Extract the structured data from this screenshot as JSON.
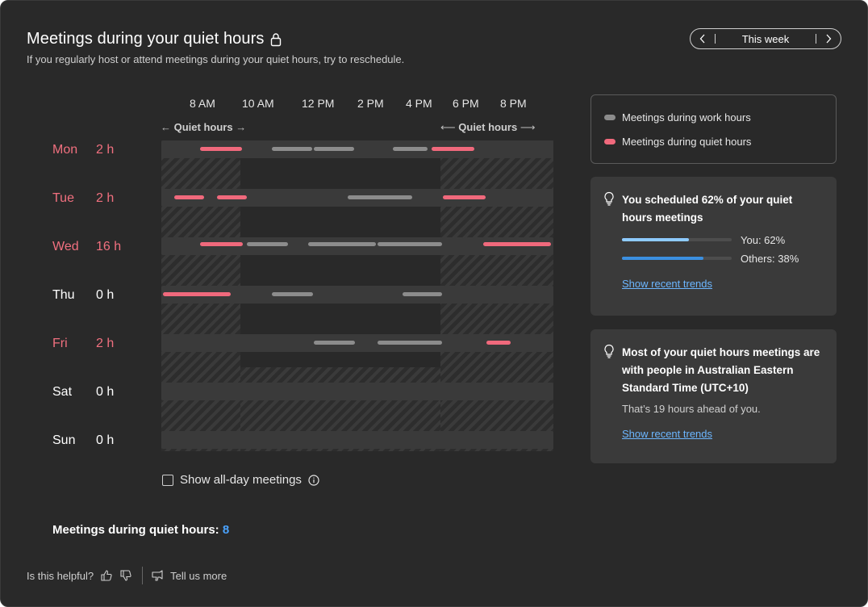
{
  "header": {
    "title": "Meetings during your quiet hours",
    "subtitle": "If you regularly host or attend meetings during your quiet hours, try to reschedule.",
    "week_label": "This week"
  },
  "timeline": {
    "hours": [
      "8 AM",
      "10 AM",
      "12 PM",
      "2 PM",
      "4 PM",
      "6 PM",
      "8 PM"
    ],
    "quiet_hours_label": "Quiet hours",
    "work_hours": {
      "start": "10 AM",
      "end": "6 PM"
    }
  },
  "days": [
    {
      "name": "Mon",
      "hours": "2 h",
      "has_quiet": true
    },
    {
      "name": "Tue",
      "hours": "2 h",
      "has_quiet": true
    },
    {
      "name": "Wed",
      "hours": "16 h",
      "has_quiet": true
    },
    {
      "name": "Thu",
      "hours": "0 h",
      "has_quiet": false
    },
    {
      "name": "Fri",
      "hours": "2 h",
      "has_quiet": true
    },
    {
      "name": "Sat",
      "hours": "0 h",
      "has_quiet": false
    },
    {
      "name": "Sun",
      "hours": "0 h",
      "has_quiet": false
    }
  ],
  "options": {
    "all_day_label": "Show all-day meetings"
  },
  "summary": {
    "label": "Meetings during quiet hours:",
    "count": "8"
  },
  "feedback": {
    "question": "Is this helpful?",
    "tell_more": "Tell us more"
  },
  "legend": {
    "work": "Meetings during work hours",
    "quiet": "Meetings during quiet hours"
  },
  "insight1": {
    "heading": "You scheduled 62% of your quiet hours meetings",
    "you_label": "You: 62%",
    "others_label": "Others: 38%",
    "you_value": 0.62,
    "others_value": 0.38,
    "link": "Show recent trends"
  },
  "insight2": {
    "heading": "Most of your quiet hours meetings are with people in Australian Eastern Standard Time (UTC+10)",
    "note": "That’s 19 hours ahead of you.",
    "link": "Show recent trends"
  },
  "colors": {
    "quiet": "#f0697c",
    "work": "#8c8c8c",
    "accent": "#4aa3ff",
    "you_bar": "#8ecbff",
    "others_bar": "#3b8fe0"
  },
  "icons": [
    "lock-icon",
    "chevron-left-icon",
    "chevron-right-icon",
    "info-icon",
    "thumbs-up-icon",
    "thumbs-down-icon",
    "feedback-icon",
    "lightbulb-icon"
  ]
}
